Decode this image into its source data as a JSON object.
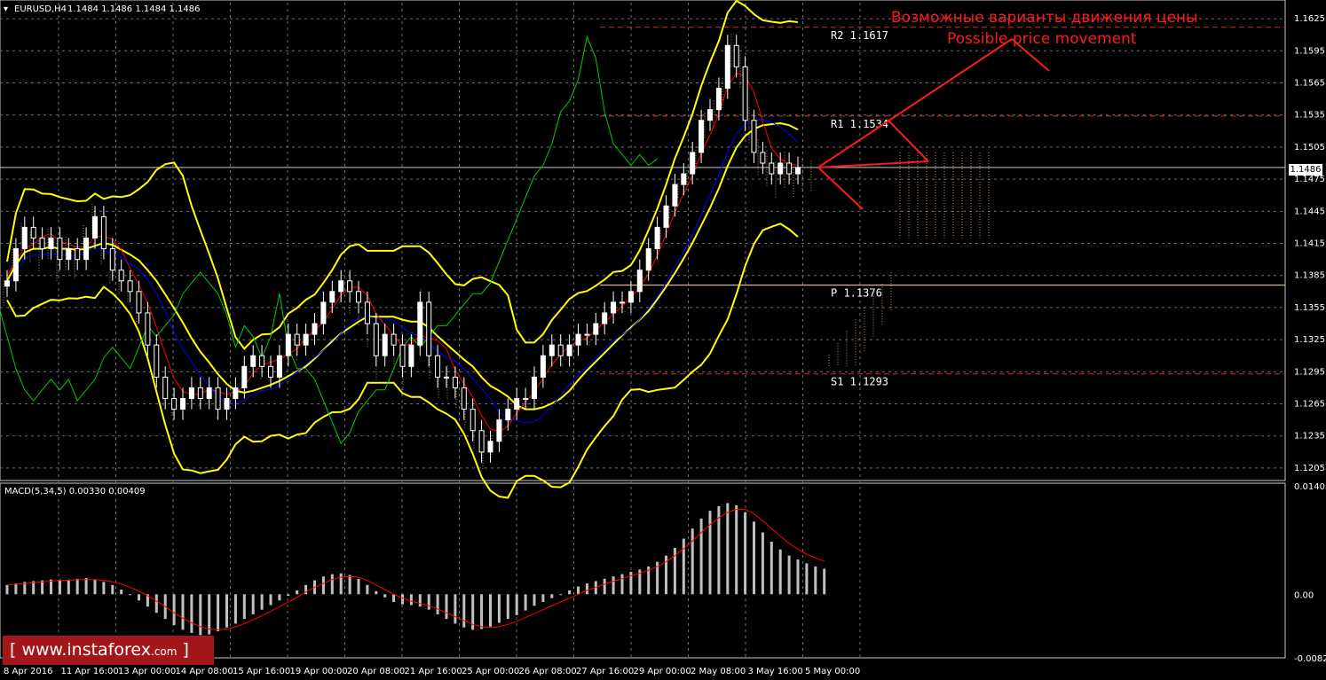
{
  "header": {
    "symbol": "EURUSD,H4",
    "ohlc": "1.1484 1.1486 1.1484 1.1486"
  },
  "macd_header": "MACD(5,34,5) 0.00330 0.00409",
  "current_price": "1.1486",
  "annotation": {
    "line1": "Возможные варианты движения цены",
    "line2": "Possible price movement"
  },
  "watermark": {
    "bracket_open": "[",
    "text": " www.instaforex",
    "suffix": ".com",
    "bracket_close": " ]"
  },
  "levels": [
    {
      "label": "R2",
      "value": "1.1617",
      "price": 1.1617,
      "style": "dashed",
      "color": "#c83232"
    },
    {
      "label": "R1",
      "value": "1.1534",
      "price": 1.1534,
      "style": "dashed",
      "color": "#c83232"
    },
    {
      "label": "P",
      "value": "1.1376",
      "price": 1.1376,
      "style": "solid",
      "color": "#ffdd99"
    },
    {
      "label": "S1",
      "value": "1.1293",
      "price": 1.1293,
      "style": "dashed",
      "color": "#c83232"
    }
  ],
  "colors": {
    "background": "#000000",
    "grid": "#6e6e6e",
    "candle": "#ffffff",
    "bollinger": "#ffff00",
    "tenkan": "#ff0000",
    "kijun": "#0000ff",
    "chikou": "#00cc00",
    "cloud": "#ffb080",
    "macd_hist": "#c0c0c0",
    "macd_signal": "#ff0000",
    "annotation": "#ff1a1a"
  },
  "chart_data": [
    {
      "type": "candlestick",
      "title": "EURUSD,H4",
      "ylim": [
        1.1195,
        1.164
      ],
      "y_ticks": [
        "1.1625",
        "1.1595",
        "1.1565",
        "1.1535",
        "1.1505",
        "1.1475",
        "1.1445",
        "1.1415",
        "1.1385",
        "1.1355",
        "1.1325",
        "1.1295",
        "1.1265",
        "1.1235",
        "1.1205"
      ],
      "x_ticks": [
        "8 Apr 2016",
        "11 Apr 16:00",
        "13 Apr 00:00",
        "14 Apr 08:00",
        "15 Apr 16:00",
        "19 Apr 00:00",
        "20 Apr 08:00",
        "21 Apr 16:00",
        "25 Apr 00:00",
        "26 Apr 08:00",
        "27 Apr 16:00",
        "29 Apr 00:00",
        "2 May 08:00",
        "3 May 16:00",
        "5 May 00:00"
      ],
      "close_series": [
        1.138,
        1.141,
        1.143,
        1.142,
        1.141,
        1.142,
        1.14,
        1.141,
        1.14,
        1.142,
        1.144,
        1.141,
        1.139,
        1.138,
        1.137,
        1.135,
        1.132,
        1.129,
        1.127,
        1.126,
        1.127,
        1.128,
        1.127,
        1.128,
        1.126,
        1.127,
        1.128,
        1.13,
        1.131,
        1.13,
        1.129,
        1.131,
        1.133,
        1.132,
        1.133,
        1.134,
        1.136,
        1.137,
        1.138,
        1.137,
        1.136,
        1.134,
        1.131,
        1.133,
        1.132,
        1.13,
        1.132,
        1.136,
        1.131,
        1.129,
        1.129,
        1.128,
        1.126,
        1.124,
        1.122,
        1.123,
        1.125,
        1.126,
        1.127,
        1.127,
        1.129,
        1.131,
        1.132,
        1.131,
        1.132,
        1.133,
        1.133,
        1.134,
        1.135,
        1.136,
        1.136,
        1.137,
        1.139,
        1.141,
        1.143,
        1.145,
        1.147,
        1.148,
        1.15,
        1.153,
        1.154,
        1.156,
        1.16,
        1.158,
        1.153,
        1.15,
        1.149,
        1.148,
        1.149,
        1.148,
        1.1486
      ]
    },
    {
      "type": "bar",
      "title": "MACD(5,34,5) 0.00330 0.00409",
      "ylim": [
        -0.00823,
        0.01403
      ],
      "y_ticks": [
        "0.01403",
        "0.00",
        "-0.00823"
      ],
      "histogram": [
        0.0012,
        0.0014,
        0.0016,
        0.0017,
        0.0018,
        0.0019,
        0.0019,
        0.0019,
        0.002,
        0.0021,
        0.0019,
        0.0016,
        0.0012,
        0.0006,
        0.0,
        -0.0008,
        -0.0016,
        -0.0024,
        -0.0032,
        -0.004,
        -0.0046,
        -0.005,
        -0.0053,
        -0.0052,
        -0.0048,
        -0.0043,
        -0.0038,
        -0.0032,
        -0.0026,
        -0.002,
        -0.0014,
        -0.0008,
        -0.0002,
        0.0005,
        0.0012,
        0.0018,
        0.0023,
        0.0026,
        0.0027,
        0.0025,
        0.002,
        0.0012,
        0.0004,
        -0.0004,
        -0.001,
        -0.0013,
        -0.0014,
        -0.0016,
        -0.002,
        -0.0026,
        -0.0032,
        -0.0038,
        -0.0043,
        -0.0046,
        -0.0045,
        -0.0042,
        -0.0037,
        -0.0032,
        -0.0027,
        -0.0021,
        -0.0015,
        -0.001,
        -0.0005,
        0.0,
        0.0005,
        0.001,
        0.0014,
        0.0017,
        0.002,
        0.0023,
        0.0026,
        0.0029,
        0.0032,
        0.0036,
        0.0042,
        0.005,
        0.006,
        0.0072,
        0.0085,
        0.0098,
        0.0108,
        0.0114,
        0.0118,
        0.0115,
        0.0106,
        0.0094,
        0.008,
        0.0068,
        0.0058,
        0.005,
        0.0045,
        0.004,
        0.0036,
        0.0033
      ],
      "signal": [
        0.0012,
        0.0013,
        0.0014,
        0.0015,
        0.0016,
        0.0017,
        0.0018,
        0.0018,
        0.0019,
        0.0019,
        0.0019,
        0.0018,
        0.0016,
        0.0013,
        0.0009,
        0.0004,
        -0.0002,
        -0.0009,
        -0.0016,
        -0.0024,
        -0.0031,
        -0.0037,
        -0.0042,
        -0.0045,
        -0.0046,
        -0.0045,
        -0.0042,
        -0.0038,
        -0.0033,
        -0.0028,
        -0.0022,
        -0.0016,
        -0.001,
        -0.0004,
        0.0003,
        0.0009,
        0.0014,
        0.0019,
        0.0022,
        0.0023,
        0.0022,
        0.0018,
        0.0012,
        0.0006,
        0.0,
        -0.0005,
        -0.0009,
        -0.0012,
        -0.0015,
        -0.0019,
        -0.0024,
        -0.0029,
        -0.0034,
        -0.0039,
        -0.0042,
        -0.0043,
        -0.0042,
        -0.0039,
        -0.0035,
        -0.003,
        -0.0025,
        -0.002,
        -0.0015,
        -0.001,
        -0.0005,
        0.0,
        0.0005,
        0.0009,
        0.0013,
        0.0017,
        0.002,
        0.0024,
        0.0027,
        0.0031,
        0.0036,
        0.0042,
        0.005,
        0.0059,
        0.0069,
        0.008,
        0.009,
        0.0099,
        0.0106,
        0.011,
        0.011,
        0.0104,
        0.0095,
        0.0085,
        0.0075,
        0.0066,
        0.0058,
        0.0052,
        0.0047,
        0.0043
      ]
    }
  ]
}
